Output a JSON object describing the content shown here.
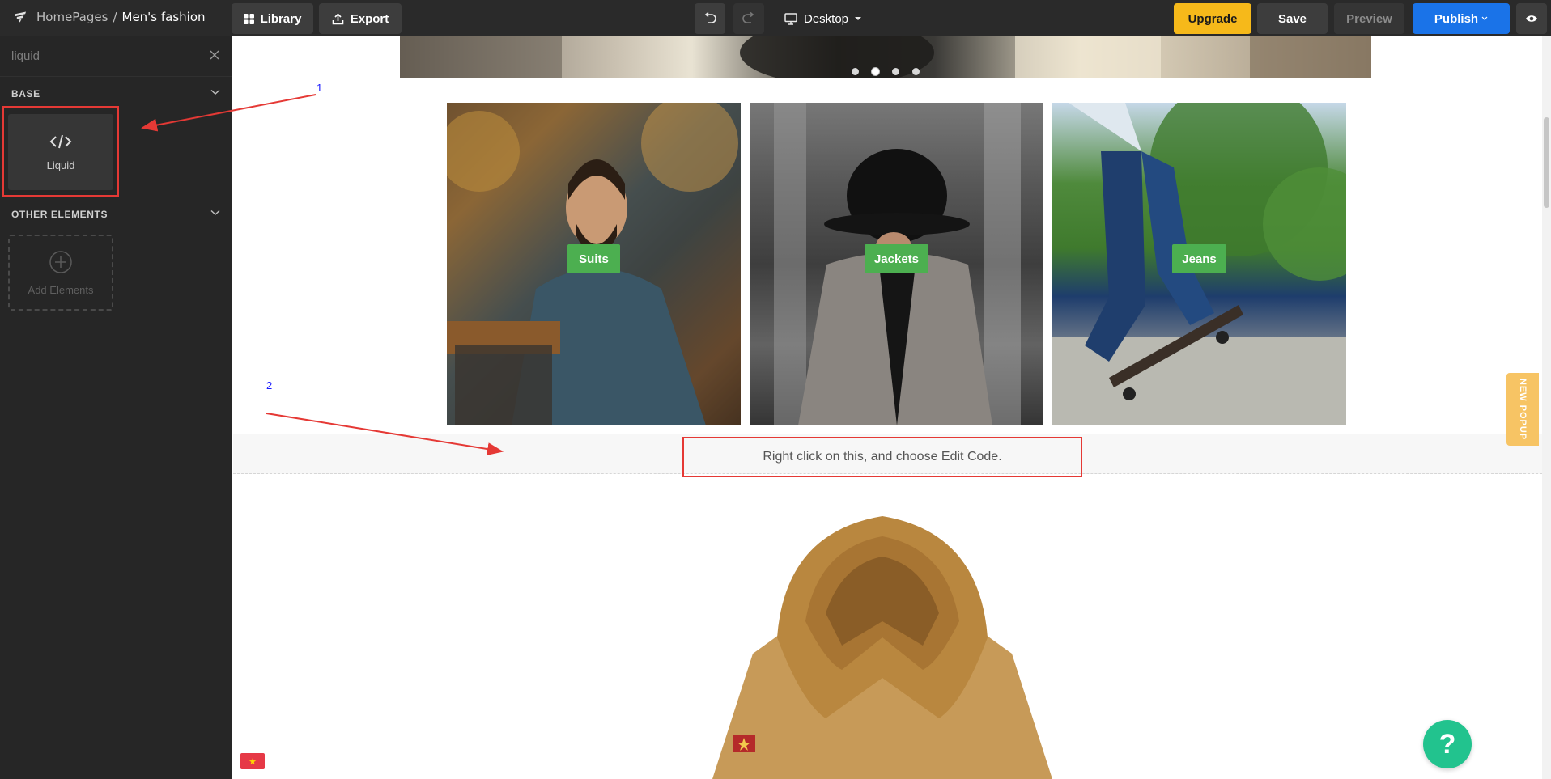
{
  "topbar": {
    "breadcrumb_root": "HomePages",
    "breadcrumb_sep": "/",
    "breadcrumb_current": "Men's fashion",
    "library_label": "Library",
    "export_label": "Export",
    "device_label": "Desktop",
    "upgrade_label": "Upgrade",
    "save_label": "Save",
    "preview_label": "Preview",
    "publish_label": "Publish"
  },
  "sidebar": {
    "search_value": "liquid",
    "base_heading": "BASE",
    "liquid_tile_label": "Liquid",
    "other_heading": "OTHER ELEMENTS",
    "add_elements_label": "Add Elements"
  },
  "canvas": {
    "categories": [
      {
        "label": "Suits"
      },
      {
        "label": "Jackets"
      },
      {
        "label": "Jeans"
      }
    ],
    "liquid_placeholder": "Right click on this, and choose Edit Code.",
    "popup_tab_label": "NEW POPUP",
    "help_label": "?"
  },
  "annotations": {
    "step1": "1",
    "step2": "2"
  },
  "colors": {
    "accent": "#1a73e8",
    "upgrade": "#f6b91a",
    "category_label": "#4caf50",
    "annotation": "#e53935",
    "help": "#22c38e"
  },
  "icons": {
    "logo": "brand-logo-icon",
    "library": "grid-icon",
    "export": "upload-icon",
    "undo": "undo-icon",
    "redo": "redo-icon",
    "device": "monitor-icon",
    "eye": "eye-icon",
    "liquid": "code-icon",
    "add": "plus-circle-icon"
  }
}
